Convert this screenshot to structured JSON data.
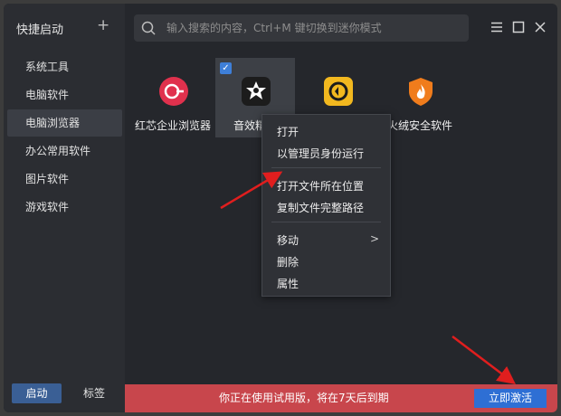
{
  "sidebar": {
    "header": "快捷启动",
    "add_label": "+",
    "items": [
      {
        "label": "系统工具"
      },
      {
        "label": "电脑软件"
      },
      {
        "label": "电脑浏览器",
        "active": true
      },
      {
        "label": "办公常用软件"
      },
      {
        "label": "图片软件"
      },
      {
        "label": "游戏软件"
      }
    ],
    "bottom": {
      "start_label": "启动",
      "tag_label": "标签"
    }
  },
  "search": {
    "placeholder": "输入搜索的内容，Ctrl+M 键切换到迷你模式"
  },
  "window_controls": [
    "menu-icon",
    "maximize-icon",
    "close-icon"
  ],
  "apps": [
    {
      "label": "红芯企业浏览器",
      "icon": "hongxin-browser-icon",
      "color": "#e0314d"
    },
    {
      "label": "音效精灵",
      "icon": "sound-effect-icon",
      "color": "#1c1c1c",
      "selected": true
    },
    {
      "label": "",
      "icon": "rescue-icon",
      "color": "#f2b81f"
    },
    {
      "label": "火绒安全软件",
      "icon": "huorong-security-icon",
      "color": "#f07c1c"
    }
  ],
  "context_menu": {
    "items": [
      {
        "label": "打开"
      },
      {
        "label": "以管理员身份运行"
      },
      {
        "label": "打开文件所在位置"
      },
      {
        "label": "复制文件完整路径"
      },
      {
        "label": "移动",
        "submenu": ">"
      },
      {
        "label": "删除"
      },
      {
        "label": "属性"
      }
    ]
  },
  "trial": {
    "text": "你正在使用试用版，将在7天后到期",
    "activate_label": "立即激活"
  },
  "colors": {
    "accent": "#2e6fd4",
    "trial_bar": "#c8464c",
    "annotation_arrow": "#e01e1e"
  }
}
